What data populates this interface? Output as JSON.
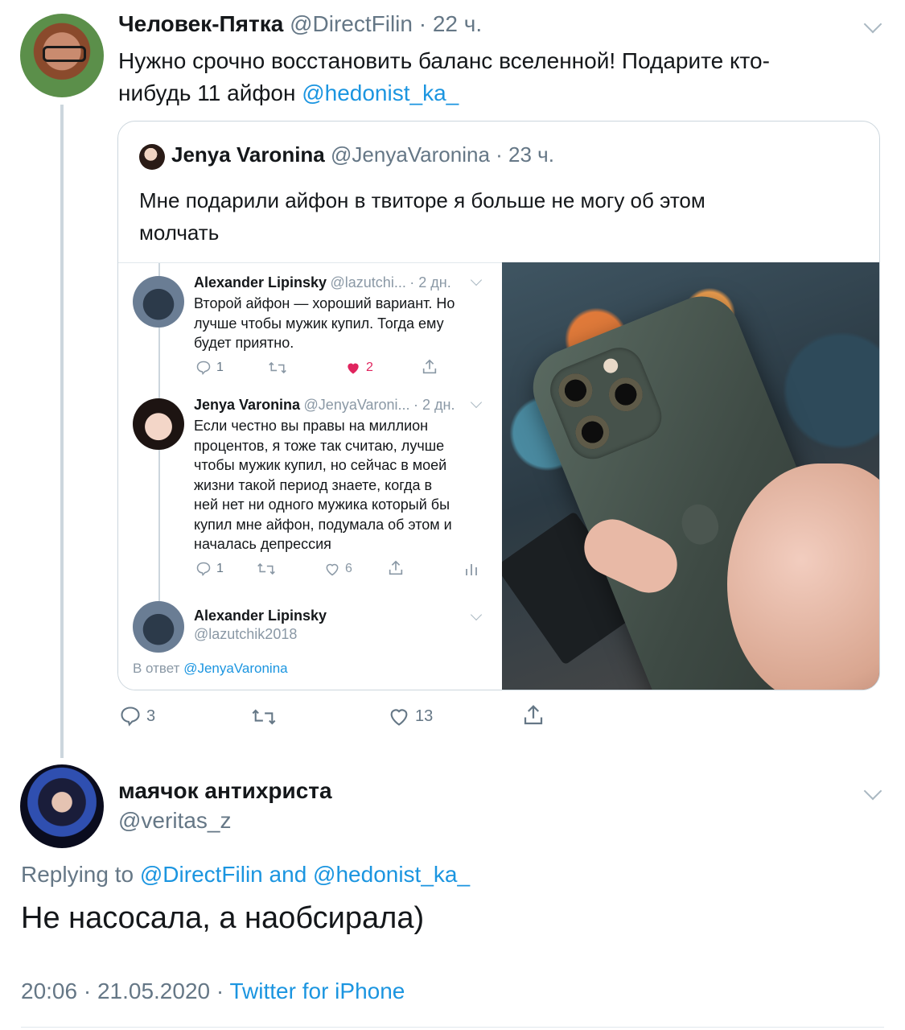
{
  "tweet": {
    "author_name": "Человек-Пятка",
    "author_handle": "@DirectFilin",
    "time": "· 22 ч.",
    "text_line1": "Нужно срочно восстановить баланс вселенной! Подарите кто-",
    "text_line2": "нибудь 11 айфон",
    "mention": "@hedonist_ka_",
    "actions": {
      "replies": "3",
      "likes": "13"
    }
  },
  "quoted": {
    "author_name": "Jenya Varonina",
    "author_handle": "@JenyaVaronina",
    "time": "· 23 ч.",
    "text_line1": "Мне подарили айфон в твиторе я больше не могу об этом",
    "text_line2": "молчать"
  },
  "screenshot": {
    "t1": {
      "name": "Alexander Lipinsky",
      "handle": "@lazutchi...",
      "time": "· 2 дн.",
      "lines": [
        "Второй айфон — хороший вариант. Но",
        "лучше чтобы мужик купил. Тогда ему",
        "будет приятно."
      ],
      "replies": "1",
      "likes": "2"
    },
    "t2": {
      "name": "Jenya Varonina",
      "handle": "@JenyaVaroni...",
      "time": "· 2 дн.",
      "lines": [
        "Если честно вы правы на миллион",
        "процентов, я тоже так считаю, лучше",
        "чтобы мужик купил, но сейчас в моей",
        "жизни такой период знаете, когда в",
        "ней нет ни одного мужика который бы",
        "купил мне айфон, подумала об этом и",
        "началась депрессия"
      ],
      "replies": "1",
      "likes": "6"
    },
    "t3": {
      "name": "Alexander Lipinsky",
      "handle": "@lazutchik2018",
      "reply_prefix": "В ответ",
      "reply_to": "@JenyaVaronina"
    }
  },
  "reply": {
    "author_name": "маячок антихриста",
    "author_handle": "@veritas_z",
    "replying_label": "Replying to",
    "replying_to_1": "@DirectFilin",
    "replying_and": "and",
    "replying_to_2": "@hedonist_ka_",
    "text": "Не насосала, а наобсирала)",
    "timestamp": "20:06 · 21.05.2020 ·",
    "source": "Twitter for iPhone"
  },
  "colors": {
    "link": "#1b95e0",
    "muted": "#657786",
    "border": "#ccd6dd",
    "like_red": "#e0245e"
  }
}
